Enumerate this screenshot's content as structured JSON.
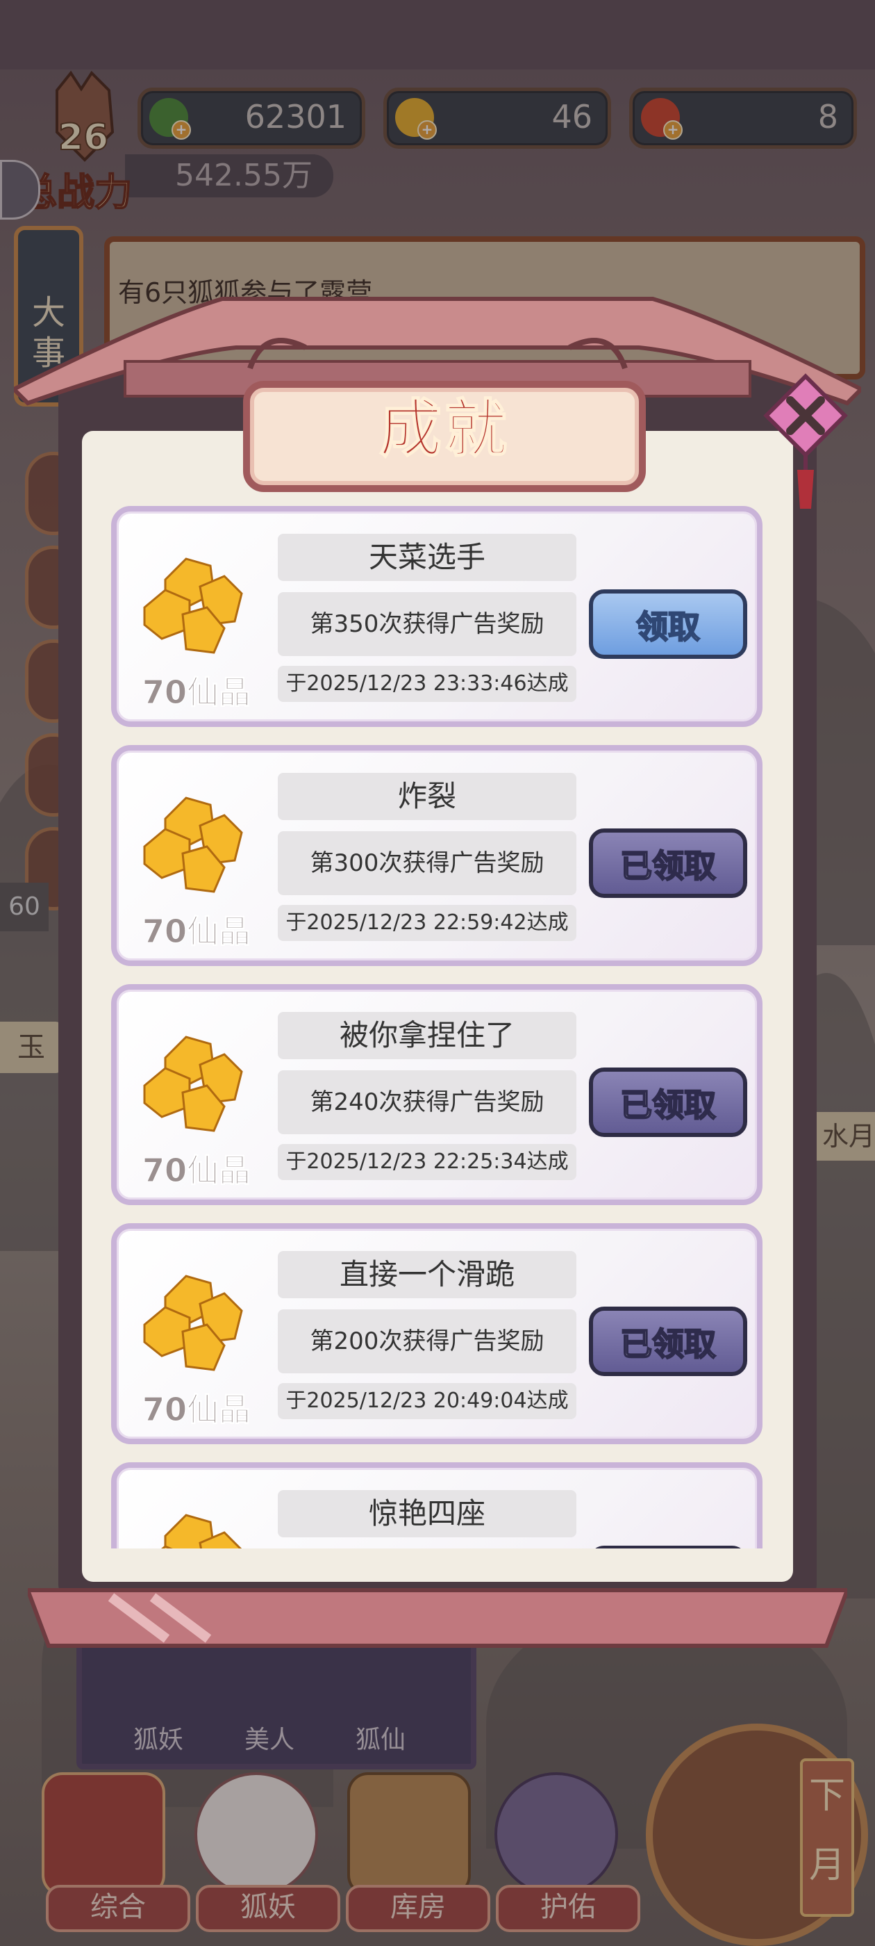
{
  "resources": [
    {
      "name": "jade",
      "value": "62301",
      "color": "#4c8a3a"
    },
    {
      "name": "crystal",
      "value": "46",
      "color": "#e6b02e"
    },
    {
      "name": "peach",
      "value": "8",
      "color": "#c9452e"
    }
  ],
  "player": {
    "level": "26",
    "power_label": "总战力",
    "power_value": "542.55万"
  },
  "events": {
    "side_label": "大事",
    "lines": [
      "有6只狐狐参与了露营"
    ]
  },
  "side_badge": "60",
  "left_tag": "玉",
  "right_tag": "水月",
  "modal": {
    "title": "成就"
  },
  "achievements": [
    {
      "name": "天菜选手",
      "desc": "第350次获得广告奖励",
      "date": "于2025/12/23  23:33:46达成",
      "reward": "70仙晶",
      "button": "领取",
      "state": "claimable"
    },
    {
      "name": "炸裂",
      "desc": "第300次获得广告奖励",
      "date": "于2025/12/23  22:59:42达成",
      "reward": "70仙晶",
      "button": "已领取",
      "state": "claimed"
    },
    {
      "name": "被你拿捏住了",
      "desc": "第240次获得广告奖励",
      "date": "于2025/12/23  22:25:34达成",
      "reward": "70仙晶",
      "button": "已领取",
      "state": "claimed"
    },
    {
      "name": "直接一个滑跪",
      "desc": "第200次获得广告奖励",
      "date": "于2025/12/23  20:49:04达成",
      "reward": "70仙晶",
      "button": "已领取",
      "state": "claimed"
    },
    {
      "name": "惊艳四座",
      "desc": "",
      "date": "",
      "reward": "",
      "button": "",
      "state": "partial"
    }
  ],
  "sub_tabs": [
    "狐妖",
    "美人",
    "狐仙"
  ],
  "nav": [
    "综合",
    "狐妖",
    "库房",
    "护佑"
  ],
  "month_label": "下月"
}
